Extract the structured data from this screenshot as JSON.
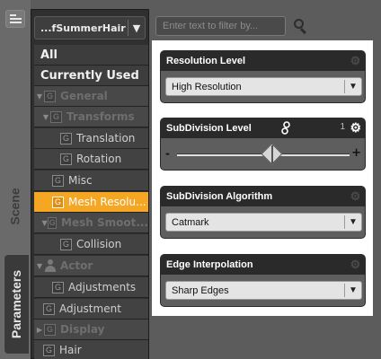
{
  "side_tabs": {
    "scene": "Scene",
    "parameters": "Parameters"
  },
  "node_selector": {
    "value": "...fSummerHair",
    "arrow": "▼"
  },
  "filter": {
    "placeholder": "Enter text to filter by..."
  },
  "tree": {
    "all": "All",
    "currently_used": "Currently Used",
    "general": "General",
    "transforms": "Transforms",
    "translation": "Translation",
    "rotation": "Rotation",
    "misc": "Misc",
    "mesh_resolution": "Mesh Resolu...",
    "mesh_smoothing": "Mesh Smoot...",
    "collision": "Collision",
    "actor": "Actor",
    "adjustments": "Adjustments",
    "adjustment": "Adjustment",
    "display": "Display",
    "hair": "Hair",
    "group_icon": "G"
  },
  "properties": {
    "resolution_level": {
      "label": "Resolution Level",
      "value": "High Resolution"
    },
    "subdivision_level": {
      "label": "SubDivision Level",
      "value_display": "1",
      "minus": "-",
      "plus": "+",
      "slider_fraction": 0.55
    },
    "subdivision_algorithm": {
      "label": "SubDivision Algorithm",
      "value": "Catmark"
    },
    "edge_interpolation": {
      "label": "Edge Interpolation",
      "value": "Sharp Edges"
    }
  },
  "colors": {
    "selection": "#f5a623",
    "highlight_panel": "#ffffff"
  }
}
